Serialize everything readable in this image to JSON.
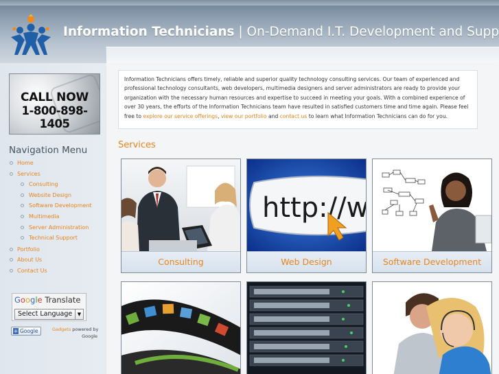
{
  "header": {
    "title_bold": "Information Technicians",
    "title_rest": " | On-Demand I.T. Development and Support"
  },
  "sidebar": {
    "call_now": {
      "line1": "CALL NOW",
      "line2": "1-800-898-1405"
    },
    "nav_title": "Navigation Menu",
    "nav": [
      {
        "label": "Home",
        "level": 0
      },
      {
        "label": "Services",
        "level": 0
      },
      {
        "label": "Consulting",
        "level": 1
      },
      {
        "label": "Website Design",
        "level": 1
      },
      {
        "label": "Software Development",
        "level": 1
      },
      {
        "label": "Multimedia",
        "level": 1
      },
      {
        "label": "Server Administration",
        "level": 1
      },
      {
        "label": "Technical Support",
        "level": 1
      },
      {
        "label": "Portfolio",
        "level": 0
      },
      {
        "label": "About Us",
        "level": 0
      },
      {
        "label": "Contact Us",
        "level": 0
      }
    ],
    "translate": {
      "google_g": "G",
      "google_o1": "o",
      "google_o2": "o",
      "google_g2": "g",
      "google_l": "l",
      "google_e": "e",
      "translate_label": "Translate",
      "select_label": "Select Language",
      "google_button": "Google",
      "gadgets_link": "Gadgets",
      "powered_by": " powered by",
      "powered_google": "Google"
    }
  },
  "main": {
    "intro_parts": {
      "text1": "Information Technicians offers timely, reliable and superior quality technology consulting services. Our team of experienced and professional technology consultants, web developers, multimedia designers and server administrators are ready to provide your organization with the necessary human resources and expertise to succeed in meeting your goals. With a combined experience of over 30 years, the efforts of the Information Technicians team have resulted in satisfied customers time and time again. Please feel free to ",
      "link1": "explore our service offerings",
      "sep1": ", ",
      "link2": "view our portfolio",
      "sep2": " and ",
      "link3": "contact us",
      "text2": " to learn what Information Technicians can do for you."
    },
    "services_title": "Services",
    "services": [
      {
        "label": "Consulting"
      },
      {
        "label": "Web Design"
      },
      {
        "label": "Software Development"
      }
    ],
    "browser_text": "http://www."
  },
  "colors": {
    "accent": "#e8841c",
    "header_text": "#ffffff",
    "logo_blue": "#1f5fa8",
    "logo_orange": "#f08a1c"
  }
}
